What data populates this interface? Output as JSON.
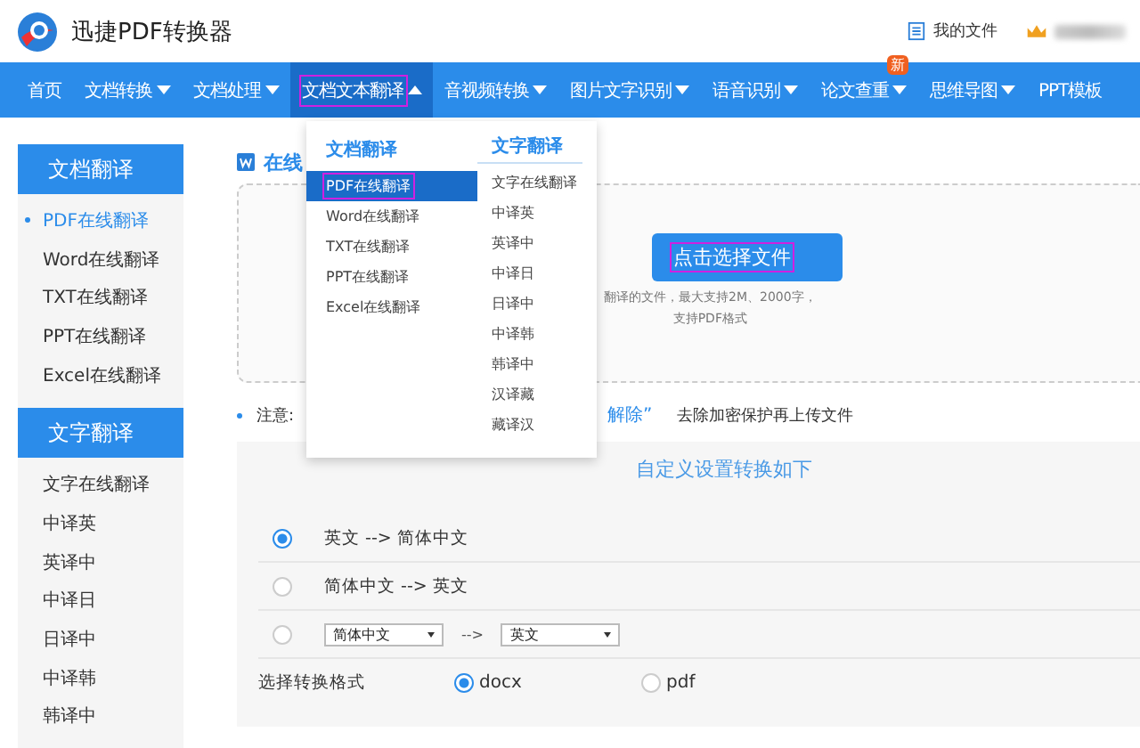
{
  "header": {
    "app_title": "迅捷PDF转换器",
    "my_files": "我的文件"
  },
  "nav": [
    {
      "label": "首页",
      "caret": false,
      "selected": false,
      "outlined": false
    },
    {
      "label": "文档转换",
      "caret": true,
      "selected": false,
      "outlined": false
    },
    {
      "label": "文档处理",
      "caret": true,
      "selected": false,
      "outlined": false
    },
    {
      "label": "文档文本翻译",
      "caret": true,
      "selected": true,
      "outlined": true
    },
    {
      "label": "音视频转换",
      "caret": true,
      "selected": false,
      "outlined": false
    },
    {
      "label": "图片文字识别",
      "caret": true,
      "selected": false,
      "outlined": false
    },
    {
      "label": "语音识别",
      "caret": true,
      "selected": false,
      "outlined": false
    },
    {
      "label": "论文查重",
      "caret": true,
      "selected": false,
      "outlined": false,
      "badge": "新"
    },
    {
      "label": "思维导图",
      "caret": true,
      "selected": false,
      "outlined": false
    },
    {
      "label": "PPT模板",
      "caret": false,
      "selected": false,
      "outlined": false
    }
  ],
  "sidebar": [
    {
      "heading": "文档翻译",
      "items": [
        {
          "label": "PDF在线翻译",
          "selected": true
        },
        {
          "label": "Word在线翻译",
          "selected": false
        },
        {
          "label": "TXT在线翻译",
          "selected": false
        },
        {
          "label": "PPT在线翻译",
          "selected": false
        },
        {
          "label": "Excel在线翻译",
          "selected": false
        }
      ]
    },
    {
      "heading": "文字翻译",
      "items": [
        {
          "label": "文字在线翻译",
          "selected": false
        },
        {
          "label": "中译英",
          "selected": false
        },
        {
          "label": "英译中",
          "selected": false
        },
        {
          "label": "中译日",
          "selected": false
        },
        {
          "label": "日译中",
          "selected": false
        },
        {
          "label": "中译韩",
          "selected": false
        },
        {
          "label": "韩译中",
          "selected": false
        }
      ]
    }
  ],
  "dropdown": {
    "columns": [
      {
        "heading": "文档翻译",
        "underlined": false,
        "items": [
          {
            "label": "PDF在线翻译",
            "selected": true,
            "outlined": true
          },
          {
            "label": "Word在线翻译",
            "selected": false,
            "outlined": false
          },
          {
            "label": "TXT在线翻译",
            "selected": false,
            "outlined": false
          },
          {
            "label": "PPT在线翻译",
            "selected": false,
            "outlined": false
          },
          {
            "label": "Excel在线翻译",
            "selected": false,
            "outlined": false
          }
        ]
      },
      {
        "heading": "文字翻译",
        "underlined": true,
        "items": [
          {
            "label": "文字在线翻译",
            "selected": false,
            "outlined": false
          },
          {
            "label": "中译英",
            "selected": false,
            "outlined": false
          },
          {
            "label": "英译中",
            "selected": false,
            "outlined": false
          },
          {
            "label": "中译日",
            "selected": false,
            "outlined": false
          },
          {
            "label": "日译中",
            "selected": false,
            "outlined": false
          },
          {
            "label": "中译韩",
            "selected": false,
            "outlined": false
          },
          {
            "label": "韩译中",
            "selected": false,
            "outlined": false
          },
          {
            "label": "汉译藏",
            "selected": false,
            "outlined": false
          },
          {
            "label": "藏译汉",
            "selected": false,
            "outlined": false
          }
        ]
      }
    ]
  },
  "main": {
    "title": "在线",
    "upload_button": "点击选择文件",
    "upload_button_outlined": true,
    "hint_lines": [
      "翻译的文件，最大支持2M、2000字，",
      "支持PDF格式"
    ],
    "note": {
      "label": "注意:",
      "link": "解除”",
      "text": "去除加密保护再上传文件"
    }
  },
  "settings": {
    "title": "自定义设置转换如下",
    "options": [
      {
        "kind": "text",
        "label": "英文 --> 简体中文",
        "selected": true
      },
      {
        "kind": "text",
        "label": "简体中文 --> 英文",
        "selected": false
      },
      {
        "kind": "selects",
        "from": "简体中文",
        "arrow": "-->",
        "to": "英文",
        "selected": false
      }
    ],
    "format_label": "选择转换格式",
    "formats": [
      {
        "label": "docx",
        "selected": true
      },
      {
        "label": "pdf",
        "selected": false
      }
    ]
  }
}
